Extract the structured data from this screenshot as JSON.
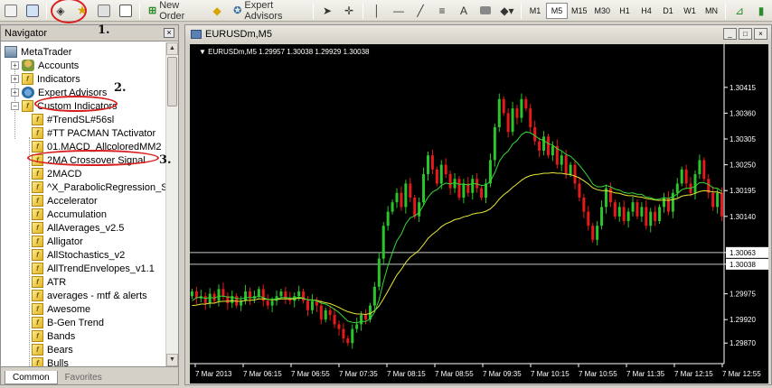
{
  "toolbar": {
    "new_order_label": "New Order",
    "expert_advisors_label": "Expert Advisors",
    "timeframes": [
      "M1",
      "M5",
      "M15",
      "M30",
      "H1",
      "H4",
      "D1",
      "W1",
      "MN"
    ],
    "active_timeframe": "M5",
    "text_tool": "A"
  },
  "navigator": {
    "title": "Navigator",
    "root": "MetaTrader",
    "groups": [
      "Accounts",
      "Indicators",
      "Expert Advisors",
      "Custom Indicators"
    ],
    "custom_indicators": [
      "#TrendSL#56sl",
      "#TT PACMAN TActivator",
      "01.MACD_AllcoloredMM2",
      "2MA Crossover Signal",
      "2MACD",
      "^X_ParabolicRegression_St",
      "Accelerator",
      "Accumulation",
      "AllAverages_v2.5",
      "Alligator",
      "AllStochastics_v2",
      "AllTrendEnvelopes_v1.1",
      "ATR",
      "averages - mtf & alerts",
      "Awesome",
      "B-Gen Trend",
      "Bands",
      "Bears",
      "Bulls"
    ],
    "tabs": [
      "Common",
      "Favorites"
    ]
  },
  "annotations": [
    "1.",
    "2.",
    "3."
  ],
  "chart_window": {
    "title": "EURUSDm,M5",
    "header": "EURUSDm,M5  1.29957 1.30038 1.29929 1.30038"
  },
  "colors": {
    "bull": "#2bc42b",
    "bear": "#e61a1a",
    "fast_ma": "#35d935",
    "slow_ma": "#e8e83a",
    "background": "#000000",
    "annotation": "#d81e1e"
  },
  "chart_data": {
    "type": "candlestick",
    "symbol": "EURUSDm",
    "timeframe": "M5",
    "ohlc_header": {
      "open": 1.29957,
      "high": 1.30038,
      "low": 1.29929,
      "close": 1.30038
    },
    "y_ticks": [
      "1.30415",
      "1.30360",
      "1.30305",
      "1.30250",
      "1.30195",
      "1.30140",
      "1.30063",
      "1.30038",
      "1.29975",
      "1.29920",
      "1.29870"
    ],
    "ylim": [
      1.2983,
      1.3048
    ],
    "price_lines": [
      1.30063,
      1.30038
    ],
    "x_ticks": [
      "7 Mar 2013",
      "7 Mar 06:15",
      "7 Mar 06:55",
      "7 Mar 07:35",
      "7 Mar 08:15",
      "7 Mar 08:55",
      "7 Mar 09:35",
      "7 Mar 10:15",
      "7 Mar 10:55",
      "7 Mar 11:35",
      "7 Mar 12:15",
      "7 Mar 12:55"
    ],
    "closes": [
      1.2998,
      1.29965,
      1.2997,
      1.29955,
      1.29975,
      1.2996,
      1.29985,
      1.2997,
      1.29955,
      1.2997,
      1.2995,
      1.2996,
      1.2998,
      1.29965,
      1.2997,
      1.29985,
      1.2996,
      1.2995,
      1.2996,
      1.2997,
      1.2998,
      1.29965,
      1.2996,
      1.2997,
      1.2998,
      1.2996,
      1.2994,
      1.2996,
      1.2995,
      1.2992,
      1.2994,
      1.2993,
      1.2991,
      1.299,
      1.2988,
      1.2987,
      1.299,
      1.2991,
      1.2993,
      1.2992,
      1.2995,
      1.2999,
      1.3005,
      1.3012,
      1.3015,
      1.3017,
      1.3019,
      1.3016,
      1.3021,
      1.3018,
      1.3014,
      1.3017,
      1.3023,
      1.3027,
      1.3024,
      1.3021,
      1.3025,
      1.3023,
      1.302,
      1.3022,
      1.3018,
      1.3021,
      1.3019,
      1.3022,
      1.302,
      1.3018,
      1.3021,
      1.3026,
      1.3033,
      1.3039,
      1.3036,
      1.3032,
      1.3037,
      1.3035,
      1.3039,
      1.3037,
      1.3033,
      1.303,
      1.3028,
      1.3031,
      1.3027,
      1.3029,
      1.3025,
      1.3027,
      1.3023,
      1.3025,
      1.3021,
      1.3018,
      1.3015,
      1.3012,
      1.3009,
      1.3012,
      1.3016,
      1.302,
      1.3017,
      1.3014,
      1.3016,
      1.3013,
      1.3015,
      1.3017,
      1.3014,
      1.3016,
      1.3012,
      1.3015,
      1.3013,
      1.3016,
      1.3018,
      1.3015,
      1.3019,
      1.3021,
      1.3024,
      1.3021,
      1.3019,
      1.3023,
      1.3026,
      1.3022,
      1.3019,
      1.3016,
      1.3019,
      1.3014
    ],
    "fast_ma": [
      1.2996,
      1.29967,
      1.29968,
      1.29965,
      1.29967,
      1.29966,
      1.2997,
      1.2997,
      1.29968,
      1.29968,
      1.29965,
      1.29964,
      1.29967,
      1.29967,
      1.29967,
      1.2997,
      1.29967,
      1.29963,
      1.29963,
      1.29964,
      1.29967,
      1.29967,
      1.29966,
      1.29966,
      1.29968,
      1.29966,
      1.29962,
      1.29962,
      1.2996,
      1.29955,
      1.29953,
      1.29948,
      1.29942,
      1.29935,
      1.29926,
      1.29917,
      1.29914,
      1.29913,
      1.29916,
      1.29916,
      1.29922,
      1.29936,
      1.29962,
      1.30001,
      1.30035,
      1.30063,
      1.30088,
      1.30102,
      1.30124,
      1.30137,
      1.30141,
      1.30148,
      1.30164,
      1.30181,
      1.30192,
      1.30197,
      1.30206,
      1.30211,
      1.30209,
      1.30212,
      1.30208,
      1.30209,
      1.30207,
      1.3021,
      1.30209,
      1.30206,
      1.30207,
      1.30215,
      1.30233,
      1.30257,
      1.30271,
      1.30279,
      1.30294,
      1.30302,
      1.30314,
      1.3032,
      1.30318,
      1.30312,
      1.30305,
      1.30302,
      1.30295,
      1.30292,
      1.30284,
      1.3028,
      1.30272,
      1.30268,
      1.30259,
      1.30249,
      1.30237,
      1.30224,
      1.30209,
      1.30203,
      1.30203,
      1.30206,
      1.30203,
      1.30198,
      1.30196,
      1.30191,
      1.30189,
      1.3019,
      1.30187,
      1.30187,
      1.30181,
      1.3018,
      1.30176,
      1.30177,
      1.3018,
      1.30178,
      1.30182,
      1.30188,
      1.30197,
      1.302,
      1.302,
      1.30204,
      1.30212,
      1.30212,
      1.30208,
      1.30201,
      1.302,
      1.30193
    ],
    "slow_ma": [
      1.2995,
      1.29951,
      1.29953,
      1.29953,
      1.29955,
      1.29955,
      1.29958,
      1.29959,
      1.29959,
      1.2996,
      1.29959,
      1.29959,
      1.29961,
      1.29961,
      1.29962,
      1.29964,
      1.29964,
      1.29963,
      1.29962,
      1.29963,
      1.29964,
      1.29964,
      1.29964,
      1.29964,
      1.29966,
      1.29965,
      1.29962,
      1.29962,
      1.29961,
      1.29958,
      1.29956,
      1.29954,
      1.2995,
      1.29946,
      1.29941,
      1.29937,
      1.29934,
      1.29932,
      1.29932,
      1.29931,
      1.29933,
      1.29939,
      1.29949,
      1.29964,
      1.29981,
      1.29998,
      1.30015,
      1.30027,
      1.30042,
      1.30053,
      1.3006,
      1.30068,
      1.3008,
      1.30093,
      1.30102,
      1.30109,
      1.30118,
      1.30124,
      1.30128,
      1.30133,
      1.30135,
      1.30139,
      1.30141,
      1.30145,
      1.30147,
      1.30148,
      1.30151,
      1.30156,
      1.30165,
      1.30177,
      1.30186,
      1.30193,
      1.30202,
      1.30209,
      1.30217,
      1.30223,
      1.30227,
      1.30229,
      1.3023,
      1.30232,
      1.30232,
      1.30233,
      1.30232,
      1.30232,
      1.3023,
      1.30229,
      1.30226,
      1.30222,
      1.30216,
      1.30209,
      1.30201,
      1.30197,
      1.30195,
      1.30195,
      1.30193,
      1.3019,
      1.30189,
      1.30186,
      1.30184,
      1.30184,
      1.30182,
      1.30181,
      1.30178,
      1.30177,
      1.30175,
      1.30174,
      1.30175,
      1.30174,
      1.30176,
      1.30178,
      1.30183,
      1.30185,
      1.30186,
      1.30189,
      1.30193,
      1.30195,
      1.30194,
      1.30192,
      1.30192,
      1.30189
    ]
  }
}
